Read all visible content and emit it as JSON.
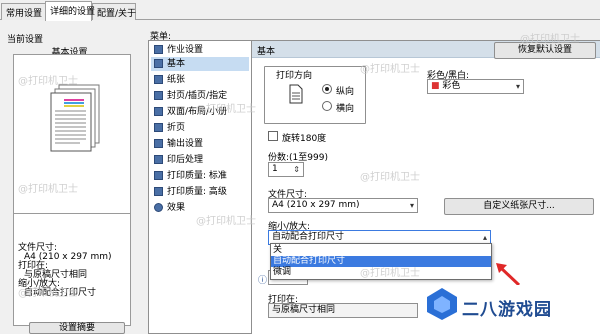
{
  "tabs": [
    {
      "label": "常用设置"
    },
    {
      "label": "详细的设置"
    },
    {
      "label": "配置/关于"
    }
  ],
  "left": {
    "current_settings": "当前设置",
    "basic_settings": "基本设置",
    "paper_size_label": "文件尺寸:",
    "paper_size_value": "A4 (210 x 297 mm)",
    "print_on_label": "打印在:",
    "print_on_value": "与原稿尺寸相同",
    "scale_label": "缩小/放大:",
    "scale_value": "自动配合打印尺寸",
    "summary_button": "设置摘要"
  },
  "menu": {
    "label": "菜单:",
    "items": [
      "作业设置",
      "基本",
      "纸张",
      "封页/插页/指定",
      "双面/布局/小册",
      "折页",
      "输出设置",
      "印后处理",
      "打印质量: 标准",
      "打印质量: 高级",
      "效果"
    ]
  },
  "main": {
    "header": "基本",
    "restore_button": "恢复默认设置",
    "orientation_label": "打印方向",
    "portrait": "纵向",
    "landscape": "横向",
    "color_label": "彩色/黑白:",
    "color_value": "彩色",
    "rotate_label": "旋转180度",
    "copies_label": "份数:(1至999)",
    "copies_value": "1",
    "paper_size_label": "文件尺寸:",
    "paper_size_value": "A4 (210 x 297 mm)",
    "custom_size_button": "自定义纸张尺寸...",
    "scale_label": "缩小/放大:",
    "scale_value": "自动配合打印尺寸",
    "scale_options": [
      "关",
      "自动配合打印尺寸",
      "微调"
    ],
    "print_on_label": "打印在:",
    "print_on_value": "与原稿尺寸相同"
  },
  "watermark": "@打印机卫士",
  "badge": {
    "text": "二八游戏园"
  },
  "colors": {
    "header_bg": "#d4dfe9",
    "selected": "#3b7ae0",
    "badge_text": "#1f4b91",
    "arrow": "#e02828"
  }
}
